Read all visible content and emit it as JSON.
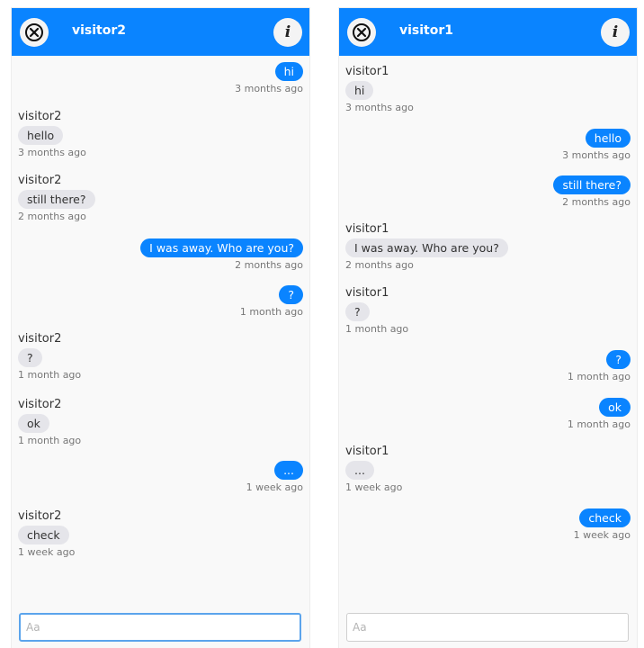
{
  "left_chat": {
    "title": "visitor2",
    "info_label": "i",
    "compose_placeholder": "Aa",
    "messages": [
      {
        "dir": "out",
        "sender": "",
        "text": "hi",
        "time": "3 months ago"
      },
      {
        "dir": "in",
        "sender": "visitor2",
        "text": "hello",
        "time": "3 months ago"
      },
      {
        "dir": "in",
        "sender": "visitor2",
        "text": "still there?",
        "time": "2 months ago"
      },
      {
        "dir": "out",
        "sender": "",
        "text": "I was away. Who are you?",
        "time": "2 months ago"
      },
      {
        "dir": "out",
        "sender": "",
        "text": "?",
        "time": "1 month ago"
      },
      {
        "dir": "in",
        "sender": "visitor2",
        "text": "?",
        "time": "1 month ago"
      },
      {
        "dir": "in",
        "sender": "visitor2",
        "text": "ok",
        "time": "1 month ago"
      },
      {
        "dir": "out",
        "sender": "",
        "text": "...",
        "time": "1 week ago"
      },
      {
        "dir": "in",
        "sender": "visitor2",
        "text": "check",
        "time": "1 week ago"
      }
    ]
  },
  "right_chat": {
    "title": "visitor1",
    "info_label": "i",
    "compose_placeholder": "Aa",
    "messages": [
      {
        "dir": "in",
        "sender": "visitor1",
        "text": "hi",
        "time": "3 months ago"
      },
      {
        "dir": "out",
        "sender": "",
        "text": "hello",
        "time": "3 months ago"
      },
      {
        "dir": "out",
        "sender": "",
        "text": "still there?",
        "time": "2 months ago"
      },
      {
        "dir": "in",
        "sender": "visitor1",
        "text": "I was away. Who are you?",
        "time": "2 months ago"
      },
      {
        "dir": "in",
        "sender": "visitor1",
        "text": "?",
        "time": "1 month ago"
      },
      {
        "dir": "out",
        "sender": "",
        "text": "?",
        "time": "1 month ago"
      },
      {
        "dir": "out",
        "sender": "",
        "text": "ok",
        "time": "1 month ago"
      },
      {
        "dir": "in",
        "sender": "visitor1",
        "text": "...",
        "time": "1 week ago"
      },
      {
        "dir": "out",
        "sender": "",
        "text": "check",
        "time": "1 week ago"
      }
    ]
  },
  "colors": {
    "accent": "#0a84ff",
    "incoming_bubble": "#e5e5ea",
    "panel_bg": "#f9f9f9"
  }
}
